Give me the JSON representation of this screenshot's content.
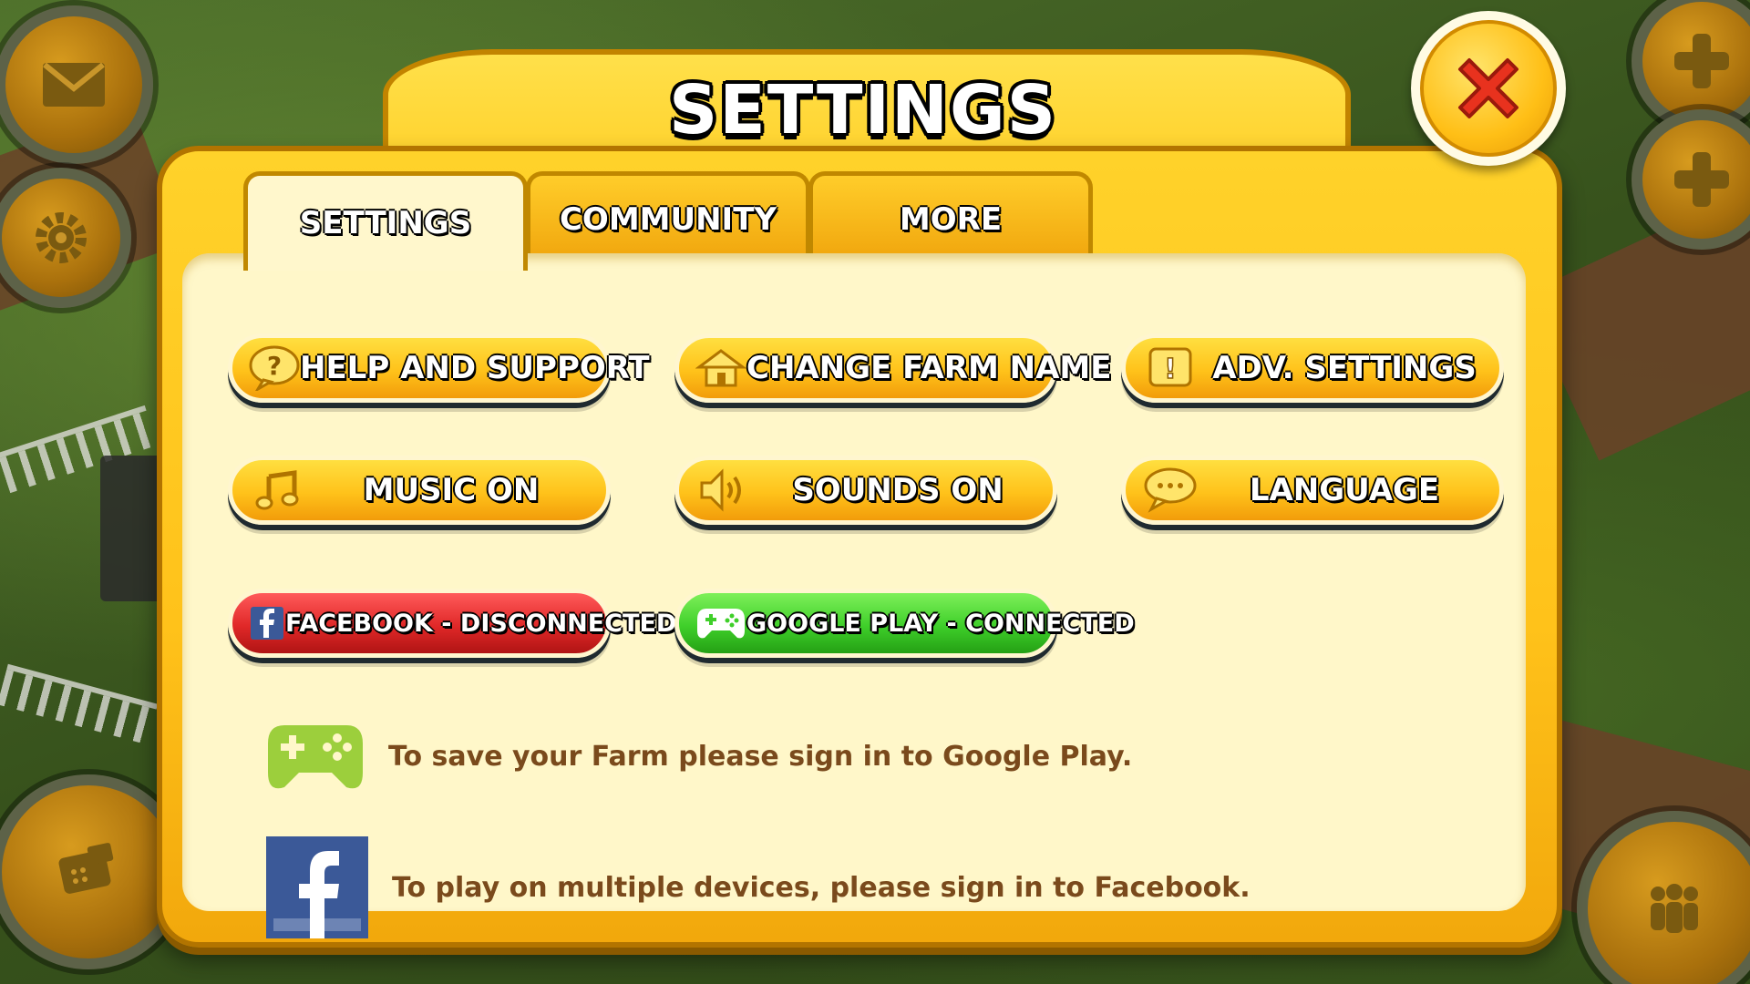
{
  "dialog": {
    "title": "SETTINGS",
    "tabs": [
      {
        "label": "SETTINGS",
        "active": true
      },
      {
        "label": "COMMUNITY",
        "active": false
      },
      {
        "label": "MORE",
        "active": false
      }
    ]
  },
  "buttons": {
    "help": {
      "label": "HELP AND SUPPORT",
      "icon": "question-bubble-icon"
    },
    "farm_name": {
      "label": "CHANGE FARM NAME",
      "icon": "house-icon"
    },
    "adv_settings": {
      "label": "ADV. SETTINGS",
      "icon": "exclamation-icon"
    },
    "music": {
      "label": "MUSIC ON",
      "icon": "music-note-icon"
    },
    "sounds": {
      "label": "SOUNDS ON",
      "icon": "speaker-icon"
    },
    "language": {
      "label": "LANGUAGE",
      "icon": "speech-bubble-icon"
    },
    "facebook": {
      "label": "FACEBOOK - DISCONNECTED",
      "icon": "facebook-icon",
      "color": "#e02828"
    },
    "google_play": {
      "label": "GOOGLE PLAY - CONNECTED",
      "icon": "gamepad-icon",
      "color": "#3fcf2a"
    }
  },
  "info": {
    "google_play_text": "To save your Farm please sign in to Google Play.",
    "facebook_text": "To play on multiple devices, please sign in to Facebook."
  },
  "colors": {
    "dialog_yellow": "#ffc21a",
    "panel_cream": "#fff7c9",
    "info_text": "#7a4a1c",
    "close_red": "#e8321e"
  }
}
